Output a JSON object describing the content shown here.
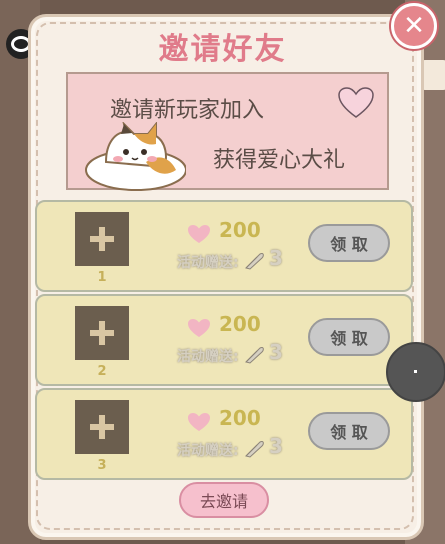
{
  "dialog": {
    "title": "邀请好友",
    "banner": {
      "line1": "邀请新玩家加入",
      "line2": "获得爱心大礼"
    },
    "rows": [
      {
        "index": "1",
        "amount": "200",
        "bonus_label": "活动赠送:",
        "bonus_count": "3",
        "claim_label": "领 取"
      },
      {
        "index": "2",
        "amount": "200",
        "bonus_label": "活动赠送:",
        "bonus_count": "3",
        "claim_label": "领 取"
      },
      {
        "index": "3",
        "amount": "200",
        "bonus_label": "活动赠送:",
        "bonus_count": "3",
        "claim_label": "领 取"
      }
    ],
    "invite_label": "去邀请"
  },
  "icons": {
    "close": "close-icon",
    "heart": "heart-icon",
    "feather": "feather-icon",
    "plus": "plus-icon",
    "cat": "cat-illustration"
  },
  "colors": {
    "title": "#e07b8a",
    "banner_bg": "#f4cfcf",
    "row_bg": "#efe6b8",
    "heart": "#f2b5c3",
    "claim_disabled": "#c9c9c9",
    "invite": "#f6c0cd"
  }
}
